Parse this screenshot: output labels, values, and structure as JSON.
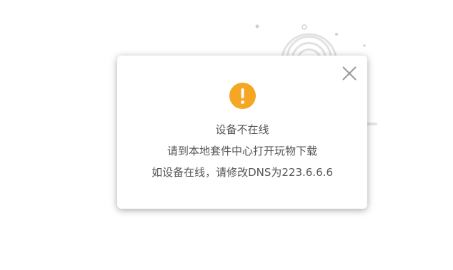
{
  "dialog": {
    "lines": [
      "设备不在线",
      "请到本地套件中心打开玩物下载",
      "如设备在线，请修改DNS为223.6.6.6"
    ]
  },
  "icons": {
    "warning": "warning-icon",
    "close": "close-icon"
  },
  "colors": {
    "warning": "#F5A623",
    "text": "#555555",
    "close": "#9a9a9a",
    "background": "#ffffff"
  }
}
